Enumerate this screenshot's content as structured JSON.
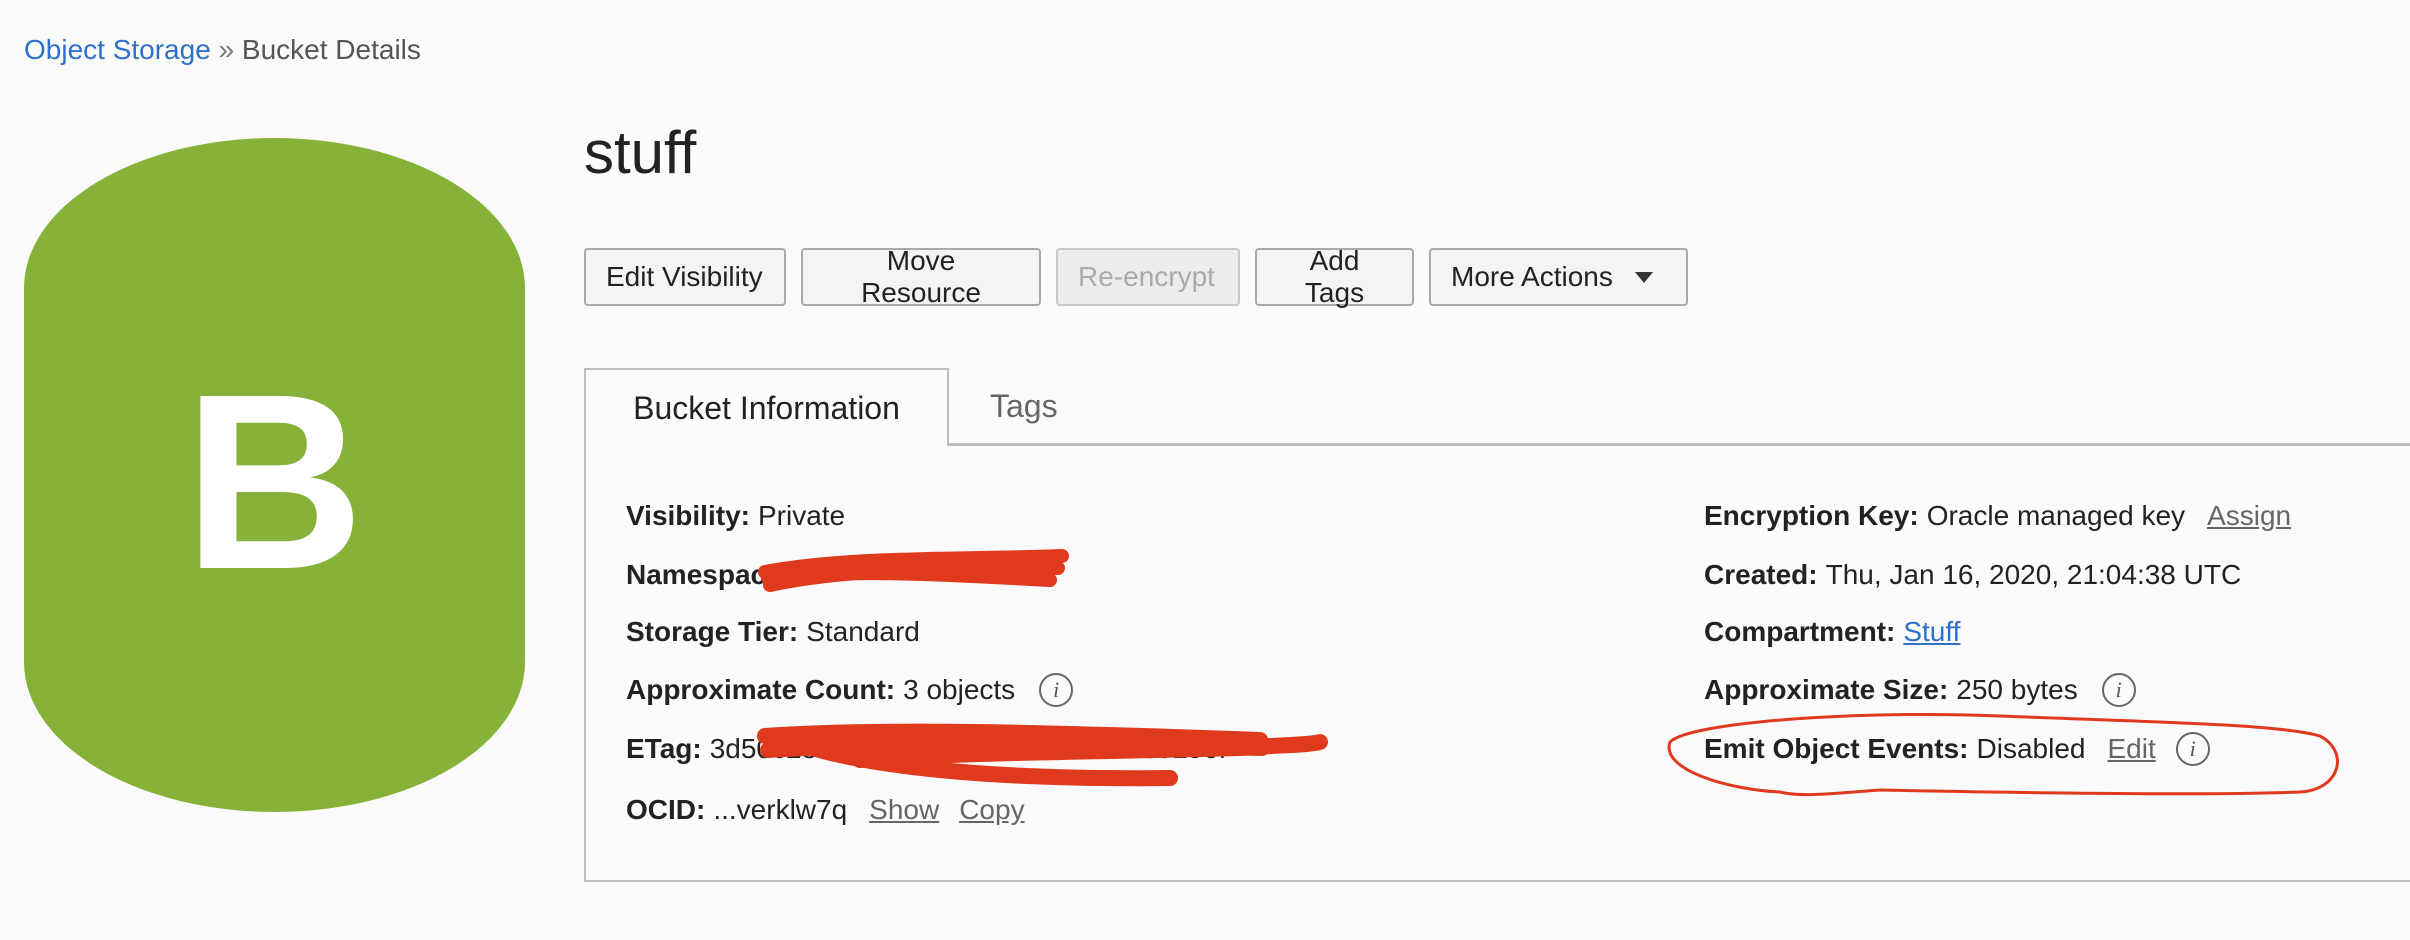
{
  "breadcrumb": {
    "root": "Object Storage",
    "separator": "»",
    "current": "Bucket Details"
  },
  "logo": {
    "letter": "B",
    "color": "#86b23a"
  },
  "bucket": {
    "name": "stuff"
  },
  "actions": {
    "edit_visibility": "Edit Visibility",
    "move_resource": "Move Resource",
    "reencrypt": "Re-encrypt",
    "add_tags": "Add Tags",
    "more_actions": "More Actions"
  },
  "tabs": {
    "info": "Bucket Information",
    "tags": "Tags"
  },
  "left": {
    "visibility": {
      "label": "Visibility:",
      "value": "Private"
    },
    "namespace": {
      "label": "Namespace:",
      "value": ""
    },
    "storage_tier": {
      "label": "Storage Tier:",
      "value": "Standard"
    },
    "approx_count": {
      "label": "Approximate Count:",
      "value": "3 objects"
    },
    "etag": {
      "label": "ETag:",
      "value": "3d50c28d-25f0-4ad8-9c01-5bd925b0190f"
    },
    "ocid": {
      "label": "OCID:",
      "value": "...verklw7q",
      "show": "Show",
      "copy": "Copy"
    }
  },
  "right": {
    "encryption": {
      "label": "Encryption Key:",
      "value": "Oracle managed key",
      "action": "Assign"
    },
    "created": {
      "label": "Created:",
      "value": "Thu, Jan 16, 2020, 21:04:38 UTC"
    },
    "compartment": {
      "label": "Compartment:",
      "value": "Stuff"
    },
    "approx_size": {
      "label": "Approximate Size:",
      "value": "250 bytes"
    },
    "emit_events": {
      "label": "Emit Object Events:",
      "value": "Disabled",
      "action": "Edit"
    }
  },
  "info_icon_glyph": "i",
  "annotation_color": "#e03a1e"
}
